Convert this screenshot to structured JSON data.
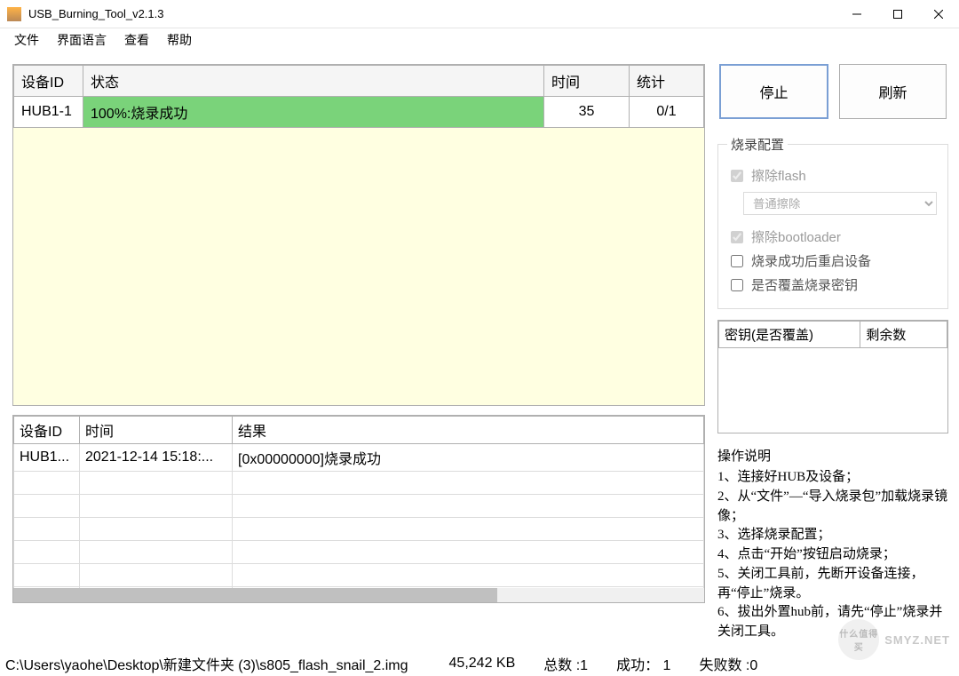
{
  "window": {
    "title": "USB_Burning_Tool_v2.1.3"
  },
  "menu": {
    "file": "文件",
    "language": "界面语言",
    "view": "查看",
    "help": "帮助"
  },
  "devtable": {
    "headers": {
      "id": "设备ID",
      "status": "状态",
      "time": "时间",
      "stat": "统计"
    },
    "row": {
      "id": "HUB1-1",
      "status": "100%:烧录成功",
      "time": "35",
      "stat": "0/1"
    }
  },
  "logtable": {
    "headers": {
      "id": "设备ID",
      "time": "时间",
      "result": "结果"
    },
    "row": {
      "id": "HUB1...",
      "time": "2021-12-14 15:18:...",
      "result": "[0x00000000]烧录成功"
    }
  },
  "buttons": {
    "stop": "停止",
    "refresh": "刷新"
  },
  "config": {
    "legend": "烧录配置",
    "eraseFlash": "擦除flash",
    "eraseType": "普通擦除",
    "eraseBootloader": "擦除bootloader",
    "rebootAfter": "烧录成功后重启设备",
    "overwriteKey": "是否覆盖烧录密钥"
  },
  "keytable": {
    "col1": "密钥(是否覆盖)",
    "col2": "剩余数"
  },
  "ops": {
    "title": "操作说明",
    "lines": [
      "1、连接好HUB及设备；",
      "2、从“文件”—“导入烧录包”加载烧录镜像；",
      "3、选择烧录配置；",
      "4、点击“开始”按钮启动烧录；",
      "5、关闭工具前，先断开设备连接，再“停止”烧录。",
      "6、拔出外置hub前，请先“停止”烧录并关闭工具。"
    ]
  },
  "status": {
    "path": "C:\\Users\\yaohe\\Desktop\\新建文件夹 (3)\\s805_flash_snail_2.img",
    "size": "45,242 KB",
    "totalLabel": "总数 :",
    "totalVal": "1",
    "okLabel": "成功：",
    "okVal": "1",
    "failLabel": "失败数 :",
    "failVal": "0"
  },
  "watermark": {
    "text": "SMYZ.NET",
    "circle": "什么值得买"
  }
}
